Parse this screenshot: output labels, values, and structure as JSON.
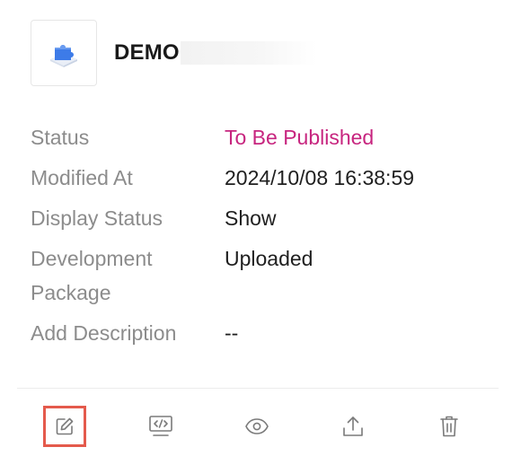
{
  "app": {
    "name": "DEMO",
    "logo_icon": "puzzle-piece-icon"
  },
  "details": [
    {
      "label": "Status",
      "value": "To Be Published",
      "value_color": "#c7257f"
    },
    {
      "label": "Modified At",
      "value": "2024/10/08 16:38:59"
    },
    {
      "label": "Display Status",
      "value": "Show"
    },
    {
      "label": "Development Package",
      "value": "Uploaded"
    },
    {
      "label": "Add Description",
      "value": "--"
    }
  ],
  "actions": [
    {
      "icon": "edit-icon",
      "selected": true,
      "highlight_color": "#e45a4c"
    },
    {
      "icon": "code-icon"
    },
    {
      "icon": "eye-icon"
    },
    {
      "icon": "upload-icon"
    },
    {
      "icon": "trash-icon"
    }
  ],
  "colors": {
    "accent_status": "#c7257f",
    "label": "#8c8c8c",
    "icon": "#7a7a7a",
    "logo_blue": "#3d7be8"
  }
}
